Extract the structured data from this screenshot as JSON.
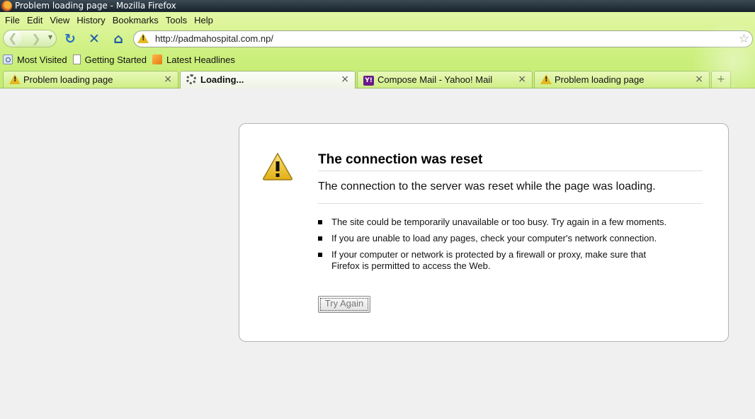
{
  "window": {
    "title": "Problem loading page - Mozilla Firefox"
  },
  "menubar": {
    "items": [
      "File",
      "Edit",
      "View",
      "History",
      "Bookmarks",
      "Tools",
      "Help"
    ]
  },
  "navbar": {
    "url": "http://padmahospital.com.np/"
  },
  "bookmarks": {
    "items": [
      "Most Visited",
      "Getting Started",
      "Latest Headlines"
    ]
  },
  "tabs": [
    {
      "label": "Problem loading page",
      "icon": "warning-icon",
      "active": false
    },
    {
      "label": "Loading...",
      "icon": "spinner-icon",
      "active": true
    },
    {
      "label": "Compose Mail - Yahoo! Mail",
      "icon": "yahoo-icon",
      "active": false
    },
    {
      "label": "Problem loading page",
      "icon": "warning-icon",
      "active": false
    }
  ],
  "tab_close_glyph": "×",
  "newtab_glyph": "+",
  "error": {
    "title": "The connection was reset",
    "description": "The connection to the server was reset while the page was loading.",
    "bullets": [
      "The site could be temporarily unavailable or too busy. Try again in a few moments.",
      "If you are unable to load any pages, check your computer's network connection.",
      "If your computer or network is protected by a firewall or proxy, make sure that Firefox is permitted to access the Web."
    ],
    "button": "Try Again"
  },
  "colors": {
    "chrome": "#cbef7c",
    "titlebar": "#18232b",
    "warning": "#e4b820",
    "nav_blue": "#1f5aa8"
  }
}
